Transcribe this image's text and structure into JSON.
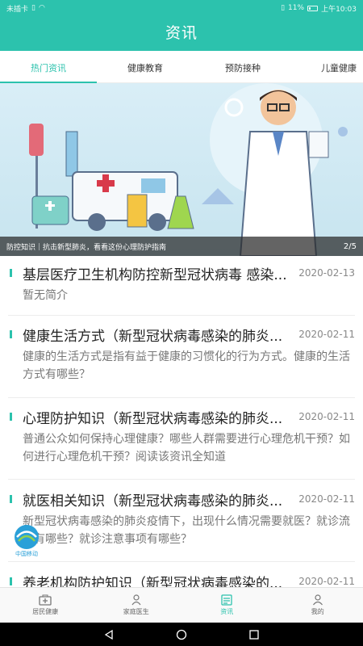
{
  "status_bar": {
    "carrier": "未插卡",
    "battery": "11%",
    "time": "上午10:03"
  },
  "header": {
    "title": "资讯"
  },
  "tabs": [
    {
      "label": "热门资讯",
      "active": true
    },
    {
      "label": "健康教育",
      "active": false
    },
    {
      "label": "预防接种",
      "active": false
    },
    {
      "label": "儿童健康",
      "active": false
    }
  ],
  "banner": {
    "caption": "防控知识｜抗击新型肺炎，看看这份心理防护指南",
    "pager": "2/5"
  },
  "articles": [
    {
      "title": "基层医疗卫生机构防控新型冠状病毒 感染...",
      "date": "2020-02-13",
      "desc": "暂无简介"
    },
    {
      "title": "健康生活方式（新型冠状病毒感染的肺炎...",
      "date": "2020-02-11",
      "desc": "健康的生活方式是指有益于健康的习惯化的行为方式。健康的生活方式有哪些？"
    },
    {
      "title": "心理防护知识（新型冠状病毒感染的肺炎...",
      "date": "2020-02-11",
      "desc": "普通公众如何保持心理健康？哪些人群需要进行心理危机干预？如何进行心理危机干预？阅读该资讯全知道"
    },
    {
      "title": "就医相关知识（新型冠状病毒感染的肺炎...",
      "date": "2020-02-11",
      "desc": "新型冠状病毒感染的肺炎疫情下，出现什么情况需要就医？就诊流程有哪些？就诊注意事项有哪些？"
    },
    {
      "title": "养老机构防护知识（新型冠状病毒感染的...",
      "date": "2020-02-11",
      "desc": ""
    }
  ],
  "logo_text": "中国移动",
  "bottom_nav": [
    {
      "label": "居民健康",
      "icon": "medical-kit-icon",
      "active": false
    },
    {
      "label": "家庭医生",
      "icon": "doctor-icon",
      "active": false
    },
    {
      "label": "资讯",
      "icon": "news-icon",
      "active": true
    },
    {
      "label": "我的",
      "icon": "person-icon",
      "active": false
    }
  ],
  "colors": {
    "accent": "#2cc2ad"
  }
}
